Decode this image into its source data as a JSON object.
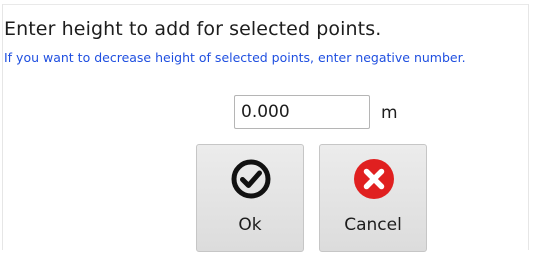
{
  "dialog": {
    "prompt": "Enter height to add for selected points.",
    "hint": "If you want to decrease height of selected points, enter negative number.",
    "height_value": "0.000",
    "unit": "m",
    "ok_label": "Ok",
    "cancel_label": "Cancel",
    "ok_icon": "checkmark-circle-icon",
    "cancel_icon": "close-circle-icon"
  },
  "colors": {
    "hint_text": "#1f4fe0",
    "cancel_icon": "#e02020",
    "ok_icon": "#111111"
  }
}
